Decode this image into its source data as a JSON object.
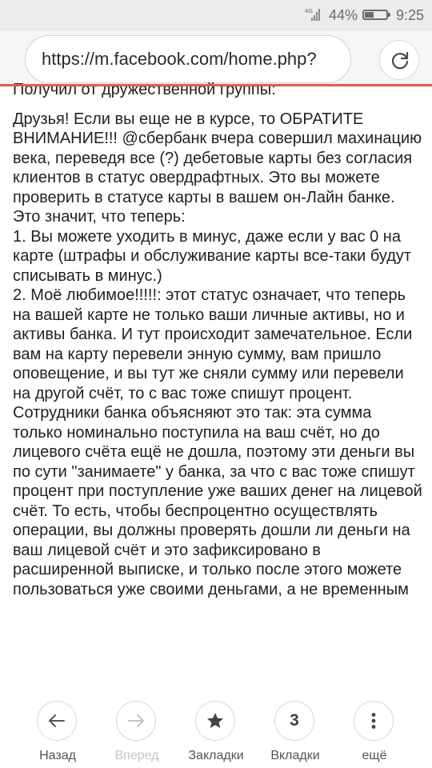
{
  "status_bar": {
    "network": "4G",
    "battery": "44%",
    "battery_level": 0.44,
    "time": "9:25"
  },
  "address_bar": {
    "url": "https://m.facebook.com/home.php?",
    "reload_icon": "reload-icon"
  },
  "post": {
    "truncated_line": "Получил от дружественной группы:",
    "paragraphs": [
      "Друзья! Если вы еще не в курсе, то ОБРАТИТЕ ВНИМАНИЕ!!! @сбербанк вчера совершил махинацию века, переведя все (?) дебетовые карты без согласия клиентов в статус овердрафтных. Это вы можете проверить в статусе карты в вашем он-Лайн банке. Это значит, что теперь:",
      "1. Вы можете уходить в минус, даже если у вас 0 на карте (штрафы и обслуживание карты все-таки будут списывать в минус.)",
      "2. Моё любимое!!!!!: этот статус означает, что теперь на вашей карте не только ваши личные активы, но и активы банка. И тут происходит замечательное. Если вам на карту перевели энную сумму, вам пришло оповещение, и вы тут же сняли сумму или перевели на другой счёт, то с вас тоже спишут процент. Сотрудники банка объясняют это так: эта сумма только номинально поступила на ваш счёт, но до лицевого счёта ещё не дошла, поэтому эти деньги вы по сути \"занимаете\" у банка, за что с вас тоже спишут процент при поступление уже ваших денег на лицевой счёт. То есть, чтобы беспроцентно осуществлять операции, вы должны проверять дошли ли деньги на ваш лицевой счёт и это зафиксировано в расширенной выписке, и только после этого можете пользоваться уже своими деньгами, а не временным"
    ]
  },
  "bottom_nav": {
    "back": {
      "label": "Назад",
      "icon": "arrow-left-icon"
    },
    "forward": {
      "label": "Вперед",
      "icon": "arrow-right-icon"
    },
    "bookmarks": {
      "label": "Закладки",
      "icon": "star-icon"
    },
    "tabs": {
      "label": "Вкладки",
      "count": "3"
    },
    "more": {
      "label": "ещё",
      "icon": "more-vertical-icon"
    }
  },
  "colors": {
    "accent": "#e0604a",
    "status_bar_bg": "#ececec",
    "disabled_text": "#c4c4c4"
  }
}
